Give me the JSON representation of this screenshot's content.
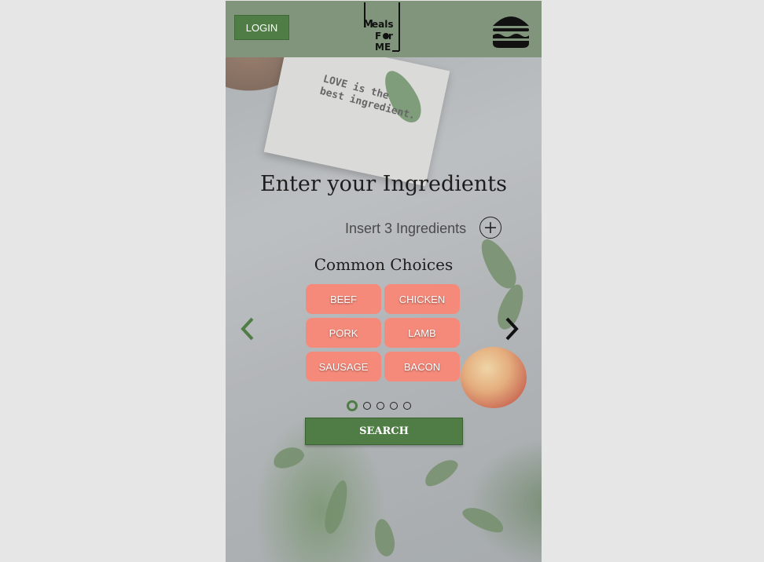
{
  "header": {
    "login_label": "LOGIN",
    "logo_text": "Meals For Me",
    "menu_icon": "hamburger-menu-icon"
  },
  "background": {
    "napkin_text_line1": "LOVE is the",
    "napkin_text_line2": "best ingredient."
  },
  "main": {
    "title": "Enter your Ingredients",
    "ingredient_input": {
      "placeholder": "Insert 3 Ingredients",
      "value": ""
    },
    "add_icon": "plus-circle-icon",
    "common_title": "Common Choices",
    "choices": [
      "BEEF",
      "CHICKEN",
      "PORK",
      "LAMB",
      "SAUSAGE",
      "BACON"
    ],
    "carousel": {
      "pages": 5,
      "active_page": 1
    },
    "search_label": "SEARCH"
  },
  "colors": {
    "header_bg": "#80957b",
    "accent_green": "#4f7d45",
    "chip_salmon": "#f58a7a"
  }
}
